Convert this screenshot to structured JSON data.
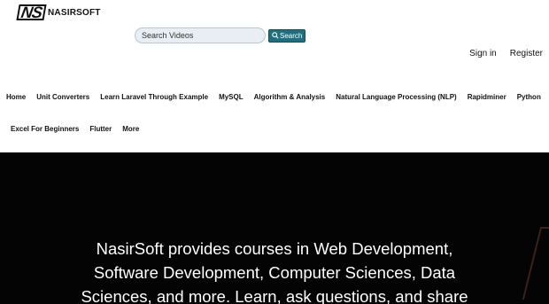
{
  "logo": {
    "mark": "NS",
    "text": "NASIRSOFT"
  },
  "search": {
    "placeholder": "Search Videos",
    "button_label": "Search"
  },
  "auth": {
    "sign_in": "Sign in",
    "register": "Register"
  },
  "nav": {
    "row1": [
      "Home",
      "Unit Converters",
      "Learn Laravel Through Example",
      "MySQL",
      "Algorithm & Analysis",
      "Natural Language Processing (NLP)",
      "Rapidminer",
      "Python"
    ],
    "row2": [
      "Excel For Beginners",
      "Flutter",
      "More"
    ]
  },
  "hero": {
    "lines": [
      "NasirSoft provides courses in Web Development,",
      "Software Development, Computer Sciences, Data",
      "Sciences, and more. Learn, ask questions, and share"
    ],
    "colors": {
      "background": "#050404",
      "text": "#ffffff"
    }
  },
  "colors": {
    "search_button": "#1f6f7f",
    "search_field": "#e8eef3"
  }
}
